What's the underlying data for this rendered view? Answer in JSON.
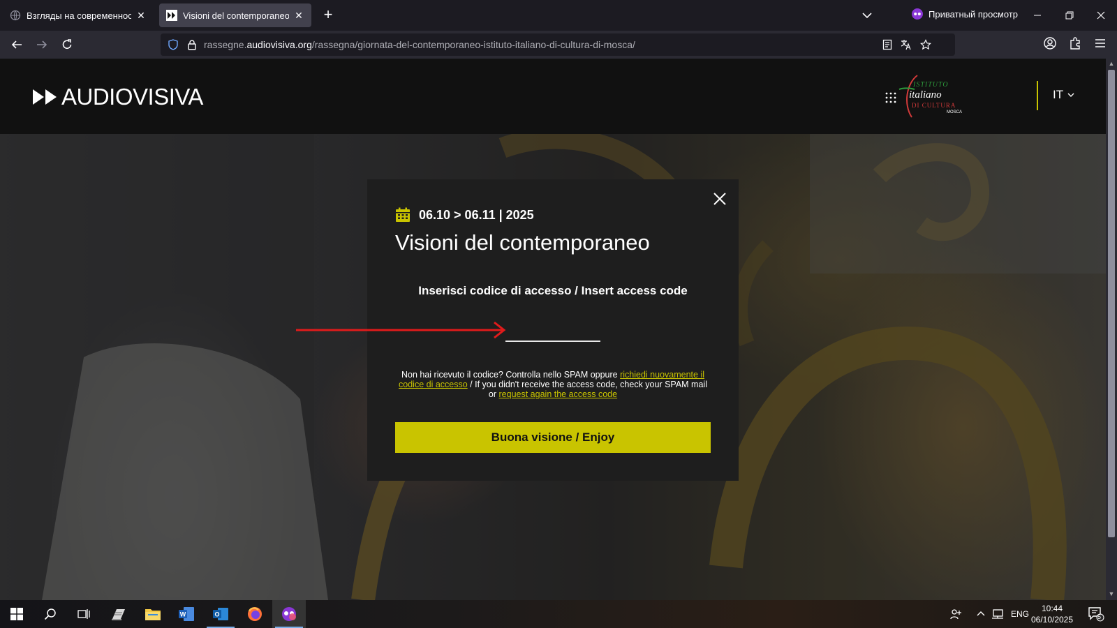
{
  "browser": {
    "tabs": [
      {
        "title": "Взгляды на современность: он",
        "active": false
      },
      {
        "title": "Visioni del contemporaneo – Au",
        "active": true
      }
    ],
    "private_label": "Приватный просмотр",
    "url_prefix": "rassegne.",
    "url_domain": "audiovisiva.org",
    "url_path": "/rassegna/giornata-del-contemporaneo-istituto-italiano-di-cultura-di-mosca/"
  },
  "site": {
    "logo_text": "AUDIOVISIVA",
    "partner_logo": {
      "line1": "ISTITUTO",
      "line2": "italiano",
      "line3": "DI CULTURA",
      "line4": "MOSCA"
    },
    "language": "IT"
  },
  "modal": {
    "date_range": "06.10 > 06.11 | 2025",
    "title": "Visioni del contemporaneo",
    "code_label": "Inserisci codice di accesso / Insert access code",
    "code_value": "",
    "help_text_1": "Non hai ricevuto il codice? Controlla nello SPAM oppure ",
    "help_link_1": "richiedi nuovamente il codice di accesso",
    "help_text_2": " / If you didn't receive the access code, check your SPAM mail or ",
    "help_link_2": "request again the access code",
    "submit_label": "Buona visione / Enjoy"
  },
  "taskbar": {
    "language": "ENG",
    "time": "10:44",
    "date": "06/10/2025",
    "notification_count": "5"
  },
  "colors": {
    "accent_yellow": "#c9c400",
    "annotation_red": "#e01b1b",
    "modal_bg": "#1e1e1e",
    "header_bg": "#111111"
  }
}
